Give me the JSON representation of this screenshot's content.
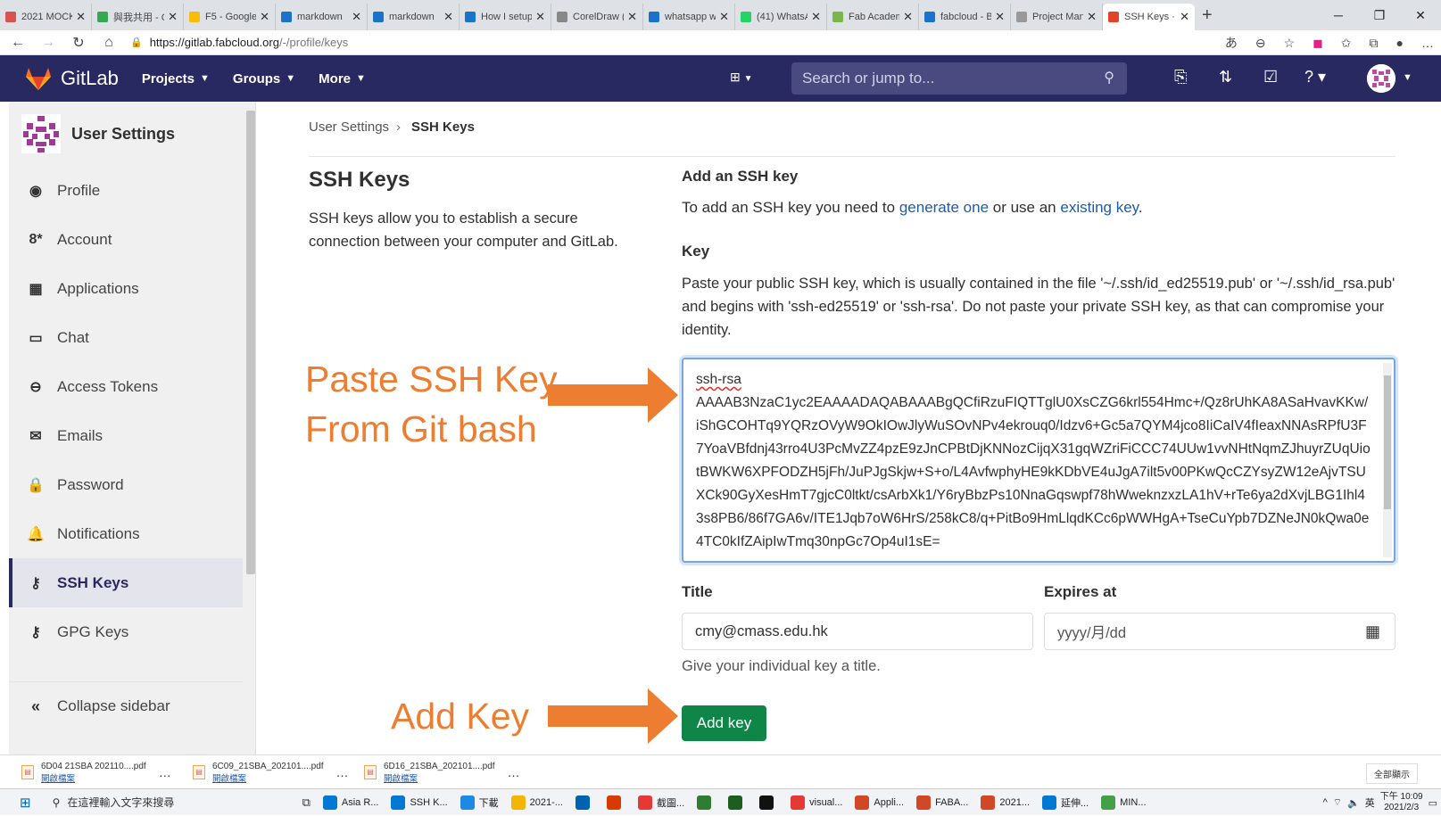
{
  "browser": {
    "tabs": [
      {
        "title": "2021 MOCK",
        "icon": "doc-icon",
        "color": "#d9534f",
        "active": false
      },
      {
        "title": "與我共用 - G",
        "icon": "drive-icon",
        "color": "#34a853",
        "active": false
      },
      {
        "title": "F5 - Google",
        "icon": "drive-icon",
        "color": "#fbbc05",
        "active": false
      },
      {
        "title": "markdown",
        "icon": "bing-icon",
        "color": "#1a73c8",
        "active": false
      },
      {
        "title": "markdown",
        "icon": "bing-icon",
        "color": "#1a73c8",
        "active": false
      },
      {
        "title": "How I setup",
        "icon": "bing-icon",
        "color": "#1a73c8",
        "active": false
      },
      {
        "title": "CorelDraw (",
        "icon": "globe-icon",
        "color": "#888888",
        "active": false
      },
      {
        "title": "whatsapp w",
        "icon": "bing-icon",
        "color": "#1a73c8",
        "active": false
      },
      {
        "title": "(41) WhatsA",
        "icon": "whatsapp-icon",
        "color": "#25d366",
        "active": false
      },
      {
        "title": "Fab Academ",
        "icon": "fab-icon",
        "color": "#7ab648",
        "active": false
      },
      {
        "title": "fabcloud - B",
        "icon": "bing-icon",
        "color": "#1a73c8",
        "active": false
      },
      {
        "title": "Project Man",
        "icon": "book-icon",
        "color": "#999999",
        "active": false
      },
      {
        "title": "SSH Keys · U",
        "icon": "gitlab-icon",
        "color": "#e24329",
        "active": true
      }
    ],
    "url_host": "https://gitlab.fabcloud.org",
    "url_path": "/-/profile/keys",
    "translate_label": "あ"
  },
  "gitlab": {
    "brand": "GitLab",
    "nav": [
      {
        "label": "Projects"
      },
      {
        "label": "Groups"
      },
      {
        "label": "More"
      }
    ],
    "search_placeholder": "Search or jump to..."
  },
  "sidebar": {
    "title": "User Settings",
    "items": [
      {
        "label": "Profile",
        "icon": "profile-icon",
        "glyph": "◉"
      },
      {
        "label": "Account",
        "icon": "account-icon",
        "glyph": "8*"
      },
      {
        "label": "Applications",
        "icon": "applications-icon",
        "glyph": "▦"
      },
      {
        "label": "Chat",
        "icon": "chat-icon",
        "glyph": "▭"
      },
      {
        "label": "Access Tokens",
        "icon": "token-icon",
        "glyph": "⊖"
      },
      {
        "label": "Emails",
        "icon": "mail-icon",
        "glyph": "✉"
      },
      {
        "label": "Password",
        "icon": "lock-icon",
        "glyph": "🔒"
      },
      {
        "label": "Notifications",
        "icon": "bell-icon",
        "glyph": "🔔"
      },
      {
        "label": "SSH Keys",
        "icon": "key-icon",
        "glyph": "⚷",
        "active": true
      },
      {
        "label": "GPG Keys",
        "icon": "key-icon",
        "glyph": "⚷"
      }
    ],
    "collapse_label": "Collapse sidebar"
  },
  "main": {
    "breadcrumb": [
      "User Settings",
      "SSH Keys"
    ],
    "section_title": "SSH Keys",
    "section_desc": "SSH keys allow you to establish a secure connection between your computer and GitLab.",
    "add_title": "Add an SSH key",
    "add_desc_1": "To add an SSH key you need to ",
    "add_link_1": "generate one",
    "add_desc_2": " or use an ",
    "add_link_2": "existing key",
    "add_desc_3": ".",
    "key_label": "Key",
    "key_help": "Paste your public SSH key, which is usually contained in the file '~/.ssh/id_ed25519.pub' or '~/.ssh/id_rsa.pub' and begins with 'ssh-ed25519' or 'ssh-rsa'. Do not paste your private SSH key, as that can compromise your identity.",
    "key_value_line1": "ssh-rsa",
    "key_value_rest": "AAAAB3NzaC1yc2EAAAADAQABAAABgQCfiRzuFIQTTglU0XsCZG6krl554Hmc+/Qz8rUhKA8ASaHvavKKw/iShGCOHTq9YQRzOVyW9OkIOwJlyWuSOvNPv4ekrouq0/Idzv6+Gc5a7QYM4jco8IiCaIV4fIeaxNNAsRPfU3F7YoaVBfdnj43rro4U3PcMvZZ4pzE9zJnCPBtDjKNNozCijqX31gqWZriFiCCC74UUw1vvNHtNqmZJhuyrZUqUiotBWKW6XPFODZH5jFh/JuPJgSkjw+S+o/L4AvfwphyHE9kKDbVE4uJgA7ilt5v00PKwQcCZYsyZW12eAjvTSUXCk90GyXesHmT7gjcC0ltkt/csArbXk1/Y6ryBbzPs10NnaGqswpf78hWweknzxzLA1hV+rTe6ya2dXvjLBG1Ihl43s8PB6/86f7GA6v/ITE1Jqb7oW6HrS/258kC8/q+PitBo9HmLlqdKCc6pWWHgA+TseCuYpb7DZNeJN0kQwa0e4TC0kIfZAipIwTmq30npGc7Op4uI1sE=",
    "title_label": "Title",
    "title_value": "cmy@cmass.edu.hk",
    "title_help": "Give your individual key a title.",
    "expires_label": "Expires at",
    "expires_placeholder": "yyyy/月/dd",
    "add_button": "Add key"
  },
  "annotations": {
    "paste_line1": "Paste SSH Key",
    "paste_line2": "From Git bash",
    "add_key": "Add Key",
    "color": "#ed7d31"
  },
  "downloads": [
    {
      "name": "6D04 21SBA 202110....pdf",
      "open": "開啟檔案"
    },
    {
      "name": "6C09_21SBA_202101....pdf",
      "open": "開啟檔案"
    },
    {
      "name": "6D16_21SBA_202101....pdf",
      "open": "開啟檔案"
    }
  ],
  "downloads_show_all": "全部顯示",
  "taskbar": {
    "search_placeholder": "在這裡輸入文字來搜尋",
    "apps": [
      {
        "label": "Asia R...",
        "color": "#0078d4"
      },
      {
        "label": "SSH K...",
        "color": "#0078d4"
      },
      {
        "label": "下載",
        "color": "#1e88e5"
      },
      {
        "label": "2021-...",
        "color": "#f4b400"
      },
      {
        "label": "",
        "color": "#0063b1"
      },
      {
        "label": "",
        "color": "#d83b01"
      },
      {
        "label": "截圖...",
        "color": "#e53935"
      },
      {
        "label": "",
        "color": "#2e7d32"
      },
      {
        "label": "",
        "color": "#1b5e20"
      },
      {
        "label": "",
        "color": "#111111"
      },
      {
        "label": "visual...",
        "color": "#e53935"
      },
      {
        "label": "Appli...",
        "color": "#d24726"
      },
      {
        "label": "FABA...",
        "color": "#d24726"
      },
      {
        "label": "2021...",
        "color": "#d24726"
      },
      {
        "label": "延伸...",
        "color": "#0078d4"
      },
      {
        "label": "MIN...",
        "color": "#43a047"
      }
    ],
    "ime": "英",
    "time": "下午 10:09",
    "date": "2021/2/3"
  }
}
